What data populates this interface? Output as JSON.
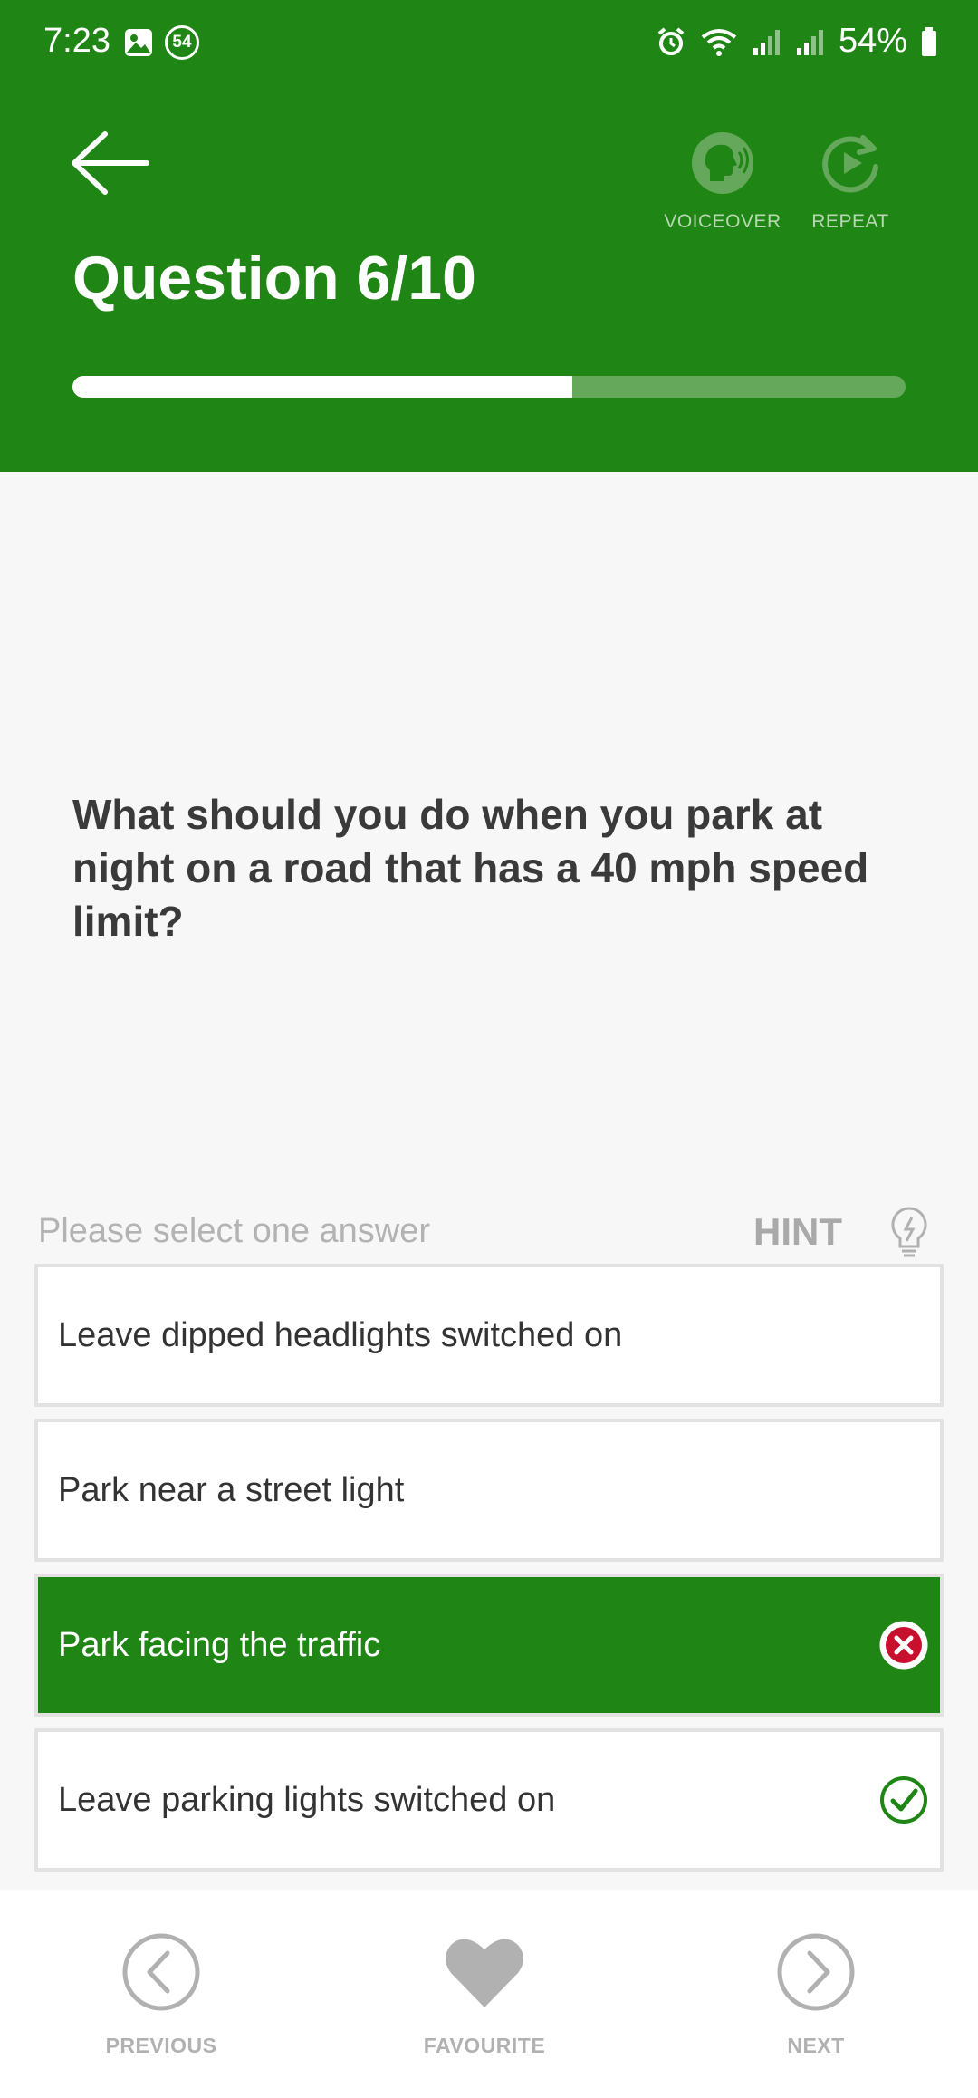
{
  "status_bar": {
    "time": "7:23",
    "notification_badge": "54",
    "battery": "54%"
  },
  "header": {
    "title": "Question 6/10",
    "voiceover_label": "VOICEOVER",
    "repeat_label": "REPEAT",
    "progress_fraction": 0.6,
    "background_color": "#1f8514"
  },
  "question": {
    "text": "What should you do when you park at night on a road that has a 40 mph speed limit?"
  },
  "answers_section": {
    "instruction": "Please select one answer",
    "hint_label": "HINT",
    "options": [
      {
        "label": "Leave dipped headlights switched on",
        "state": "none"
      },
      {
        "label": "Park near a street light",
        "state": "none"
      },
      {
        "label": "Park facing the traffic",
        "state": "selected-wrong"
      },
      {
        "label": "Leave parking lights switched on",
        "state": "correct"
      }
    ]
  },
  "bottom_nav": {
    "previous_label": "PREVIOUS",
    "favourite_label": "FAVOURITE",
    "next_label": "NEXT"
  },
  "icons": {
    "back": "arrow-left-icon",
    "voiceover": "speaking-head-icon",
    "repeat": "replay-icon",
    "hint": "lightbulb-icon",
    "wrong": "x-circle-icon",
    "correct": "check-circle-icon",
    "previous": "chevron-left-circle-icon",
    "favourite": "heart-icon",
    "next": "chevron-right-circle-icon"
  }
}
